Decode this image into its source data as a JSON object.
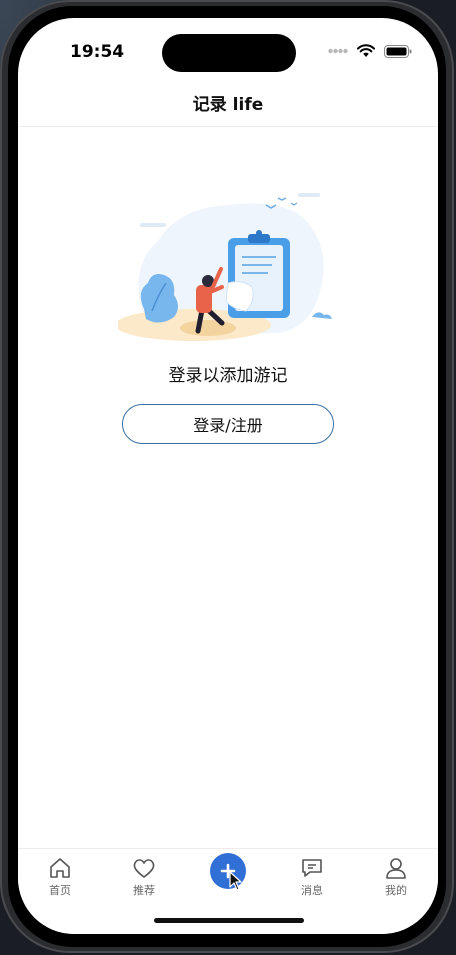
{
  "status_bar": {
    "time": "19:54"
  },
  "nav": {
    "title": "记录 life"
  },
  "empty_state": {
    "prompt": "登录以添加游记",
    "login_button_label": "登录/注册"
  },
  "tab_bar": {
    "tabs": [
      {
        "label": "首页",
        "icon": "home-icon"
      },
      {
        "label": "推荐",
        "icon": "heart-icon"
      },
      {
        "label": "",
        "icon": "add-icon"
      },
      {
        "label": "消息",
        "icon": "message-icon"
      },
      {
        "label": "我的",
        "icon": "profile-icon"
      }
    ]
  },
  "colors": {
    "accent": "#2f6fd6",
    "button_border": "#3a6ea5",
    "illustration_blue": "#4a9ee8",
    "illustration_red": "#e8634a"
  }
}
